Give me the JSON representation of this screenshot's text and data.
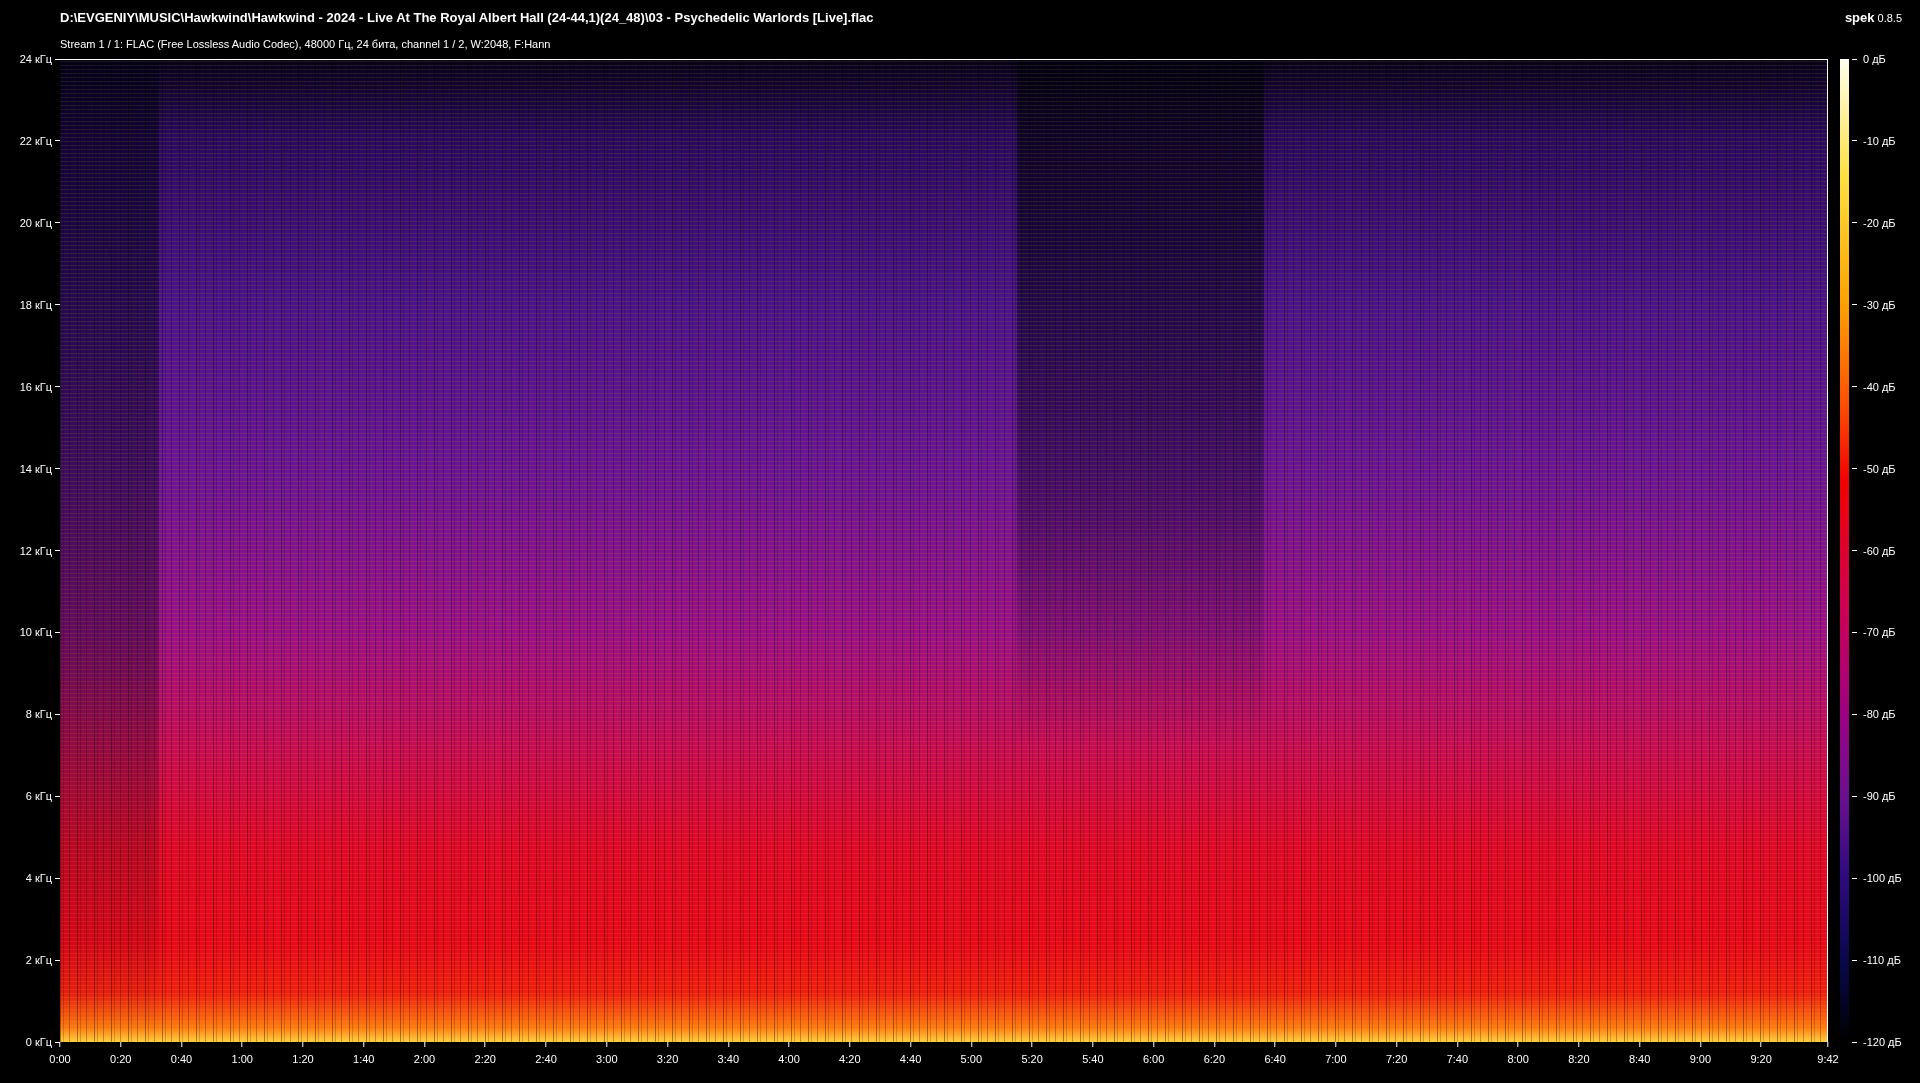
{
  "title": "D:\\EVGENIY\\MUSIC\\Hawkwind\\Hawkwind - 2024 - Live At The Royal Albert Hall (24-44,1)(24_48)\\03 - Psychedelic Warlords [Live].flac",
  "stream_info": "Stream 1 / 1: FLAC (Free Lossless Audio Codec), 48000 Гц, 24 бита, channel 1 / 2, W:2048, F:Hann",
  "app": {
    "name": "spek",
    "version": "0.8.5"
  },
  "frequency_ticks": [
    "24 кГц",
    "22 кГц",
    "20 кГц",
    "18 кГц",
    "16 кГц",
    "14 кГц",
    "12 кГц",
    "10 кГц",
    "8 кГц",
    "6 кГц",
    "4 кГц",
    "2 кГц",
    "0 кГц"
  ],
  "time_ticks": [
    "0:00",
    "0:20",
    "0:40",
    "1:00",
    "1:20",
    "1:40",
    "2:00",
    "2:20",
    "2:40",
    "3:00",
    "3:20",
    "3:40",
    "4:00",
    "4:20",
    "4:40",
    "5:00",
    "5:20",
    "5:40",
    "6:00",
    "6:20",
    "6:40",
    "7:00",
    "7:20",
    "7:40",
    "8:00",
    "8:20",
    "8:40",
    "9:00",
    "9:20",
    "9:42"
  ],
  "db_ticks": [
    "0 дБ",
    "-10 дБ",
    "-20 дБ",
    "-30 дБ",
    "-40 дБ",
    "-50 дБ",
    "-60 дБ",
    "-70 дБ",
    "-80 дБ",
    "-90 дБ",
    "-100 дБ",
    "-110 дБ",
    "-120 дБ"
  ]
}
